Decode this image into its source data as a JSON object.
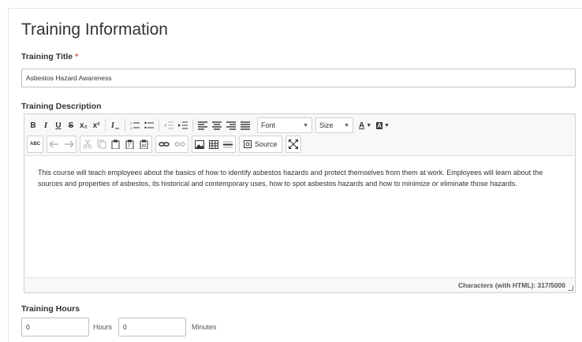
{
  "section_title": "Training Information",
  "training_title": {
    "label": "Training Title",
    "required_mark": "*",
    "value": "Asbestos Hazard Awareness"
  },
  "training_description": {
    "label": "Training Description",
    "toolbar": {
      "bold": "B",
      "italic": "I",
      "underline": "U",
      "strike": "S",
      "subscript": "x₂",
      "superscript": "x²",
      "font_combo": "Font",
      "size_combo": "Size",
      "text_color": "A",
      "bg_color": "A",
      "spellcheck": "ABC",
      "source_label": "Source"
    },
    "content": "This course will teach employees about the basics of how to identify asbestos hazards and protect themselves from them at work. Employees will learn about the sources and properties of asbestos, its historical and contemporary uses, how to spot asbestos hazards and how to minimize or eliminate those hazards.",
    "char_count": "Characters (with HTML): 317/5000"
  },
  "training_hours": {
    "label": "Training Hours",
    "hours_value": "0",
    "hours_unit": "Hours",
    "minutes_value": "0",
    "minutes_unit": "Minutes"
  }
}
